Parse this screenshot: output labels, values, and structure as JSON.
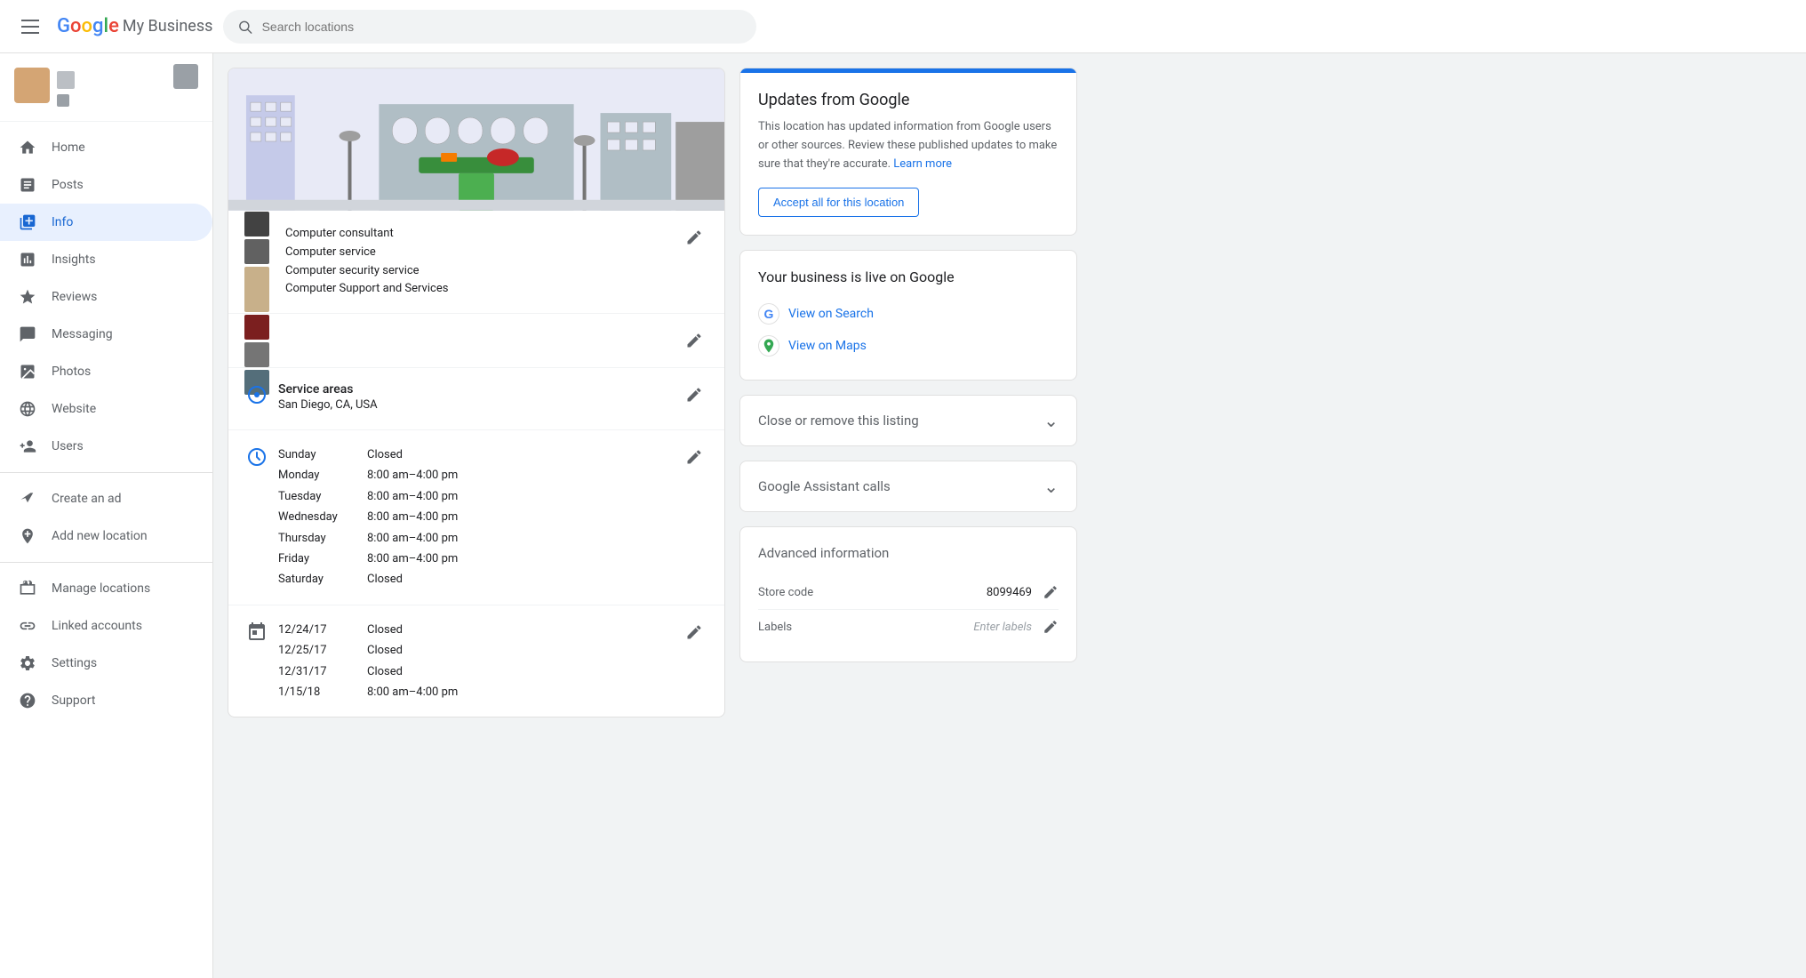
{
  "header": {
    "app_name": "Google My Business",
    "search_placeholder": "Search locations",
    "logo_google": "Google",
    "logo_mybusiness": "My Business"
  },
  "sidebar": {
    "nav_items": [
      {
        "id": "home",
        "label": "Home",
        "icon": "home-icon",
        "active": false
      },
      {
        "id": "posts",
        "label": "Posts",
        "icon": "posts-icon",
        "active": false
      },
      {
        "id": "info",
        "label": "Info",
        "icon": "info-icon",
        "active": true
      },
      {
        "id": "insights",
        "label": "Insights",
        "icon": "insights-icon",
        "active": false
      },
      {
        "id": "reviews",
        "label": "Reviews",
        "icon": "reviews-icon",
        "active": false
      },
      {
        "id": "messaging",
        "label": "Messaging",
        "icon": "messaging-icon",
        "active": false
      },
      {
        "id": "photos",
        "label": "Photos",
        "icon": "photos-icon",
        "active": false
      },
      {
        "id": "website",
        "label": "Website",
        "icon": "website-icon",
        "active": false
      },
      {
        "id": "users",
        "label": "Users",
        "icon": "users-icon",
        "active": false
      },
      {
        "id": "create-ad",
        "label": "Create an ad",
        "icon": "create-ad-icon",
        "active": false
      },
      {
        "id": "add-location",
        "label": "Add new location",
        "icon": "add-location-icon",
        "active": false
      },
      {
        "id": "manage-locations",
        "label": "Manage locations",
        "icon": "manage-locations-icon",
        "active": false
      },
      {
        "id": "linked-accounts",
        "label": "Linked accounts",
        "icon": "linked-accounts-icon",
        "active": false
      },
      {
        "id": "settings",
        "label": "Settings",
        "icon": "settings-icon",
        "active": false
      },
      {
        "id": "support",
        "label": "Support",
        "icon": "support-icon",
        "active": false
      }
    ]
  },
  "business_info": {
    "categories": [
      "Computer consultant",
      "Computer service",
      "Computer security service",
      "Computer Support and Services"
    ],
    "service_areas_label": "Service areas",
    "service_areas_value": "San Diego, CA, USA",
    "hours": [
      {
        "day": "Sunday",
        "time": "Closed"
      },
      {
        "day": "Monday",
        "time": "8:00 am–4:00 pm"
      },
      {
        "day": "Tuesday",
        "time": "8:00 am–4:00 pm"
      },
      {
        "day": "Wednesday",
        "time": "8:00 am–4:00 pm"
      },
      {
        "day": "Thursday",
        "time": "8:00 am–4:00 pm"
      },
      {
        "day": "Friday",
        "time": "8:00 am–4:00 pm"
      },
      {
        "day": "Saturday",
        "time": "Closed"
      }
    ],
    "special_hours": [
      {
        "date": "12/24/17",
        "time": "Closed"
      },
      {
        "date": "12/25/17",
        "time": "Closed"
      },
      {
        "date": "12/31/17",
        "time": "Closed"
      },
      {
        "date": "1/15/18",
        "time": "8:00 am–4:00 pm"
      }
    ]
  },
  "right_panel": {
    "updates": {
      "title": "Updates from Google",
      "description": "This location has updated information from Google users or other sources. Review these published updates to make sure that they're accurate.",
      "learn_more": "Learn more",
      "accept_button": "Accept all for this location"
    },
    "live": {
      "title": "Your business is live on Google",
      "view_search": "View on Search",
      "view_maps": "View on Maps"
    },
    "close_listing": {
      "title": "Close or remove this listing"
    },
    "assistant_calls": {
      "title": "Google Assistant calls"
    },
    "advanced": {
      "title": "Advanced information",
      "store_code_label": "Store code",
      "store_code_value": "8099469",
      "labels_label": "Labels",
      "labels_placeholder": "Enter labels"
    }
  }
}
